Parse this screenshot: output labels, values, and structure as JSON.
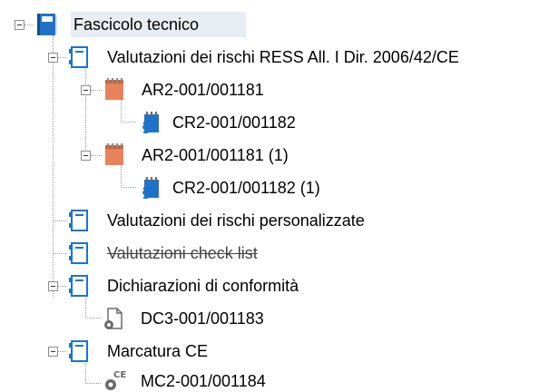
{
  "tree": {
    "root": {
      "label": "Fascicolo tecnico",
      "icon": "book-icon"
    },
    "nodes": [
      {
        "label": "Valutazioni dei rischi RESS All. I Dir. 2006/42/CE",
        "icon": "folder-icon"
      },
      {
        "label": "AR2-001/001181",
        "icon": "notepad-icon"
      },
      {
        "label": "CR2-001/001182",
        "icon": "section-doc-icon"
      },
      {
        "label": "AR2-001/001181 (1)",
        "icon": "notepad-icon"
      },
      {
        "label": "CR2-001/001182 (1)",
        "icon": "section-doc-icon"
      },
      {
        "label": "Valutazioni dei rischi personalizzate",
        "icon": "folder-icon"
      },
      {
        "label": "Valutazioni check list",
        "icon": "folder-icon",
        "strikethrough": true
      },
      {
        "label": "Dichiarazioni di conformità",
        "icon": "folder-icon"
      },
      {
        "label": "DC3-001/001183",
        "icon": "document-gear-icon"
      },
      {
        "label": "Marcatura CE",
        "icon": "folder-icon"
      },
      {
        "label": "MC2-001/001184",
        "icon": "ce-gear-icon"
      }
    ]
  },
  "colors": {
    "orange": "#e8825a",
    "blue": "#1e73c8",
    "selection": "#e8ecf3"
  }
}
